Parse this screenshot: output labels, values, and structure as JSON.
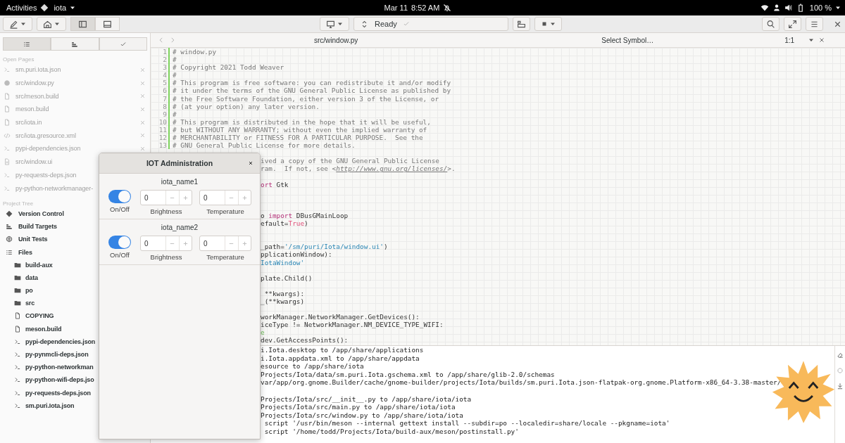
{
  "top_bar": {
    "activities": "Activities",
    "app": "iota",
    "date": "Mar 11",
    "time": "8:52 AM",
    "battery": "100 %"
  },
  "header": {
    "build_status": "Ready",
    "panes": [
      {
        "kind": "sidebar",
        "selected": true
      },
      {
        "kind": "bottom",
        "selected": false
      }
    ]
  },
  "sidebar": {
    "tabs": [
      {
        "kind": "list",
        "selected": true
      },
      {
        "kind": "targets",
        "selected": false
      },
      {
        "kind": "check",
        "selected": false
      }
    ],
    "open_pages_title": "Open Pages",
    "open_pages": [
      {
        "label": "sm.puri.Iota.json",
        "kind": "terminal"
      },
      {
        "label": "src/window.py",
        "kind": "python"
      },
      {
        "label": "src/meson.build",
        "kind": "file"
      },
      {
        "label": "meson.build",
        "kind": "file"
      },
      {
        "label": "src/iota.in",
        "kind": "file"
      },
      {
        "label": "src/iota.gresource.xml",
        "kind": "code"
      },
      {
        "label": "pypi-dependencies.json",
        "kind": "terminal"
      },
      {
        "label": "src/window.ui",
        "kind": "ui"
      },
      {
        "label": "py-requests-deps.json",
        "kind": "terminal"
      },
      {
        "label": "py-python-networkmanager-",
        "kind": "terminal"
      }
    ],
    "project_tree_title": "Project Tree",
    "project_tree": [
      {
        "label": "Version Control",
        "kind": "git"
      },
      {
        "label": "Build Targets",
        "kind": "targets"
      },
      {
        "label": "Unit Tests",
        "kind": "tests"
      },
      {
        "label": "Files",
        "kind": "list",
        "children": [
          {
            "label": "build-aux",
            "kind": "folder"
          },
          {
            "label": "data",
            "kind": "folder"
          },
          {
            "label": "po",
            "kind": "folder"
          },
          {
            "label": "src",
            "kind": "folder"
          },
          {
            "label": "COPYING",
            "kind": "file"
          },
          {
            "label": "meson.build",
            "kind": "file"
          },
          {
            "label": "pypi-dependencies.json",
            "kind": "terminal"
          },
          {
            "label": "py-pynmcli-deps.json",
            "kind": "terminal"
          },
          {
            "label": "py-python-networkman",
            "kind": "terminal"
          },
          {
            "label": "py-python-wifi-deps.jso",
            "kind": "terminal"
          },
          {
            "label": "py-requests-deps.json",
            "kind": "terminal"
          },
          {
            "label": "sm.puri.Iota.json",
            "kind": "terminal"
          }
        ]
      }
    ]
  },
  "editor": {
    "title": "src/window.py",
    "symbol_selector": "Select Symbol…",
    "cursor_position": "1:1",
    "lines": [
      {
        "kind": "numbered",
        "n": "1",
        "text": "# window.py"
      },
      {
        "kind": "numbered",
        "n": "2",
        "text": "#"
      },
      {
        "kind": "numbered",
        "n": "3",
        "text": "# Copyright 2021 Todd Weaver"
      },
      {
        "kind": "numbered",
        "n": "4",
        "text": "#"
      },
      {
        "kind": "numbered",
        "n": "5",
        "text": "# This program is free software: you can redistribute it and/or modify"
      },
      {
        "kind": "numbered",
        "n": "6",
        "text": "# it under the terms of the GNU General Public License as published by"
      },
      {
        "kind": "numbered",
        "n": "7",
        "text": "# the Free Software Foundation, either version 3 of the License, or"
      },
      {
        "kind": "numbered",
        "n": "8",
        "text": "# (at your option) any later version."
      },
      {
        "kind": "numbered",
        "n": "9",
        "text": "#"
      },
      {
        "kind": "numbered",
        "n": "10",
        "text": "# This program is distributed in the hope that it will be useful,"
      },
      {
        "kind": "numbered",
        "n": "11",
        "text": "# but WITHOUT ANY WARRANTY; without even the implied warranty of"
      },
      {
        "kind": "numbered",
        "n": "12",
        "text": "# MERCHANTABILITY or FITNESS FOR A PARTICULAR PURPOSE.  See the"
      },
      {
        "kind": "numbered",
        "n": "13",
        "text": "# GNU General Public License for more details."
      },
      {
        "kind": "covered"
      },
      {
        "kind": "covered",
        "text": "ived a copy of the GNU General Public License"
      },
      {
        "kind": "covered",
        "spans": [
          {
            "text": "ram.  If not, see <",
            "kind": "comment"
          },
          {
            "text": "http://www.gnu.org/licenses/",
            "kind": "link"
          },
          {
            "text": ">.",
            "kind": "comment"
          }
        ]
      },
      {
        "kind": "covered"
      },
      {
        "kind": "covered",
        "spans": [
          {
            "text": "ort",
            "kind": "keyword"
          },
          {
            "text": " Gtk",
            "kind": "plain"
          }
        ]
      },
      {
        "kind": "covered"
      },
      {
        "kind": "covered"
      },
      {
        "kind": "covered"
      },
      {
        "kind": "covered",
        "spans": [
          {
            "text": "o ",
            "kind": "plain"
          },
          {
            "text": "import",
            "kind": "keyword"
          },
          {
            "text": " DBusGMainLoop",
            "kind": "plain"
          }
        ]
      },
      {
        "kind": "covered",
        "spans": [
          {
            "text": "efault=",
            "kind": "plain"
          },
          {
            "text": "True",
            "kind": "constant"
          },
          {
            "text": ")",
            "kind": "plain"
          }
        ]
      },
      {
        "kind": "covered"
      },
      {
        "kind": "covered"
      },
      {
        "kind": "covered",
        "spans": [
          {
            "text": "_path=",
            "kind": "plain"
          },
          {
            "text": "'/sm/puri/Iota/window.ui'",
            "kind": "string"
          },
          {
            "text": ")",
            "kind": "plain"
          }
        ]
      },
      {
        "kind": "covered",
        "spans": [
          {
            "text": "pplicationWindow):",
            "kind": "plain"
          }
        ]
      },
      {
        "kind": "covered",
        "spans": [
          {
            "text": "IotaWindow'",
            "kind": "string"
          }
        ]
      },
      {
        "kind": "covered"
      },
      {
        "kind": "covered",
        "spans": [
          {
            "text": "plate.Child()",
            "kind": "plain"
          }
        ]
      },
      {
        "kind": "covered"
      },
      {
        "kind": "covered",
        "spans": [
          {
            "text": " **kwargs):",
            "kind": "plain"
          }
        ]
      },
      {
        "kind": "covered",
        "spans": [
          {
            "text": "_(**kwargs)",
            "kind": "plain"
          }
        ]
      },
      {
        "kind": "covered"
      },
      {
        "kind": "covered",
        "spans": [
          {
            "text": "workManager.NetworkManager.GetDevices():",
            "kind": "plain"
          }
        ]
      },
      {
        "kind": "covered",
        "spans": [
          {
            "text": "iceType != NetworkManager.NM_DEVICE_TYPE_WIFI:",
            "kind": "plain"
          }
        ]
      },
      {
        "kind": "covered",
        "spans": [
          {
            "text": "e",
            "kind": "builtin"
          }
        ]
      },
      {
        "kind": "covered",
        "spans": [
          {
            "text": "dev.GetAccessPoints():",
            "kind": "plain"
          }
        ]
      }
    ]
  },
  "terminal": {
    "blocks": [
      [
        "i.Iota.desktop to /app/share/applications",
        "i.Iota.appdata.xml to /app/share/appdata",
        "esource to /app/share/iota",
        "Projects/Iota/data/sm.puri.Iota.gschema.xml to /app/share/glib-2.0/schemas",
        "var/app/org.gnome.Builder/cache/gnome-builder/projects/Iota/builds/sm.puri.Iota.json-flatpak-org.gnome.Platform-x86_64-3.38-master/"
      ],
      [
        "Projects/Iota/src/__init__.py to /app/share/iota/iota",
        "Projects/Iota/src/main.py to /app/share/iota/iota",
        "Projects/Iota/src/window.py to /app/share/iota/iota",
        " script '/usr/bin/meson --internal gettext install --subdir=po --localedir=share/locale --pkgname=iota'",
        " script '/home/todd/Projects/Iota/build-aux/meson/postinstall.py'"
      ]
    ]
  },
  "dialog": {
    "title": "IOT Administration",
    "devices": [
      {
        "name": "iota_name1",
        "on": true,
        "switch_label": "On/Off",
        "controls": [
          {
            "value": "0",
            "label": "Brightness"
          },
          {
            "value": "0",
            "label": "Temperature"
          }
        ]
      },
      {
        "name": "iota_name2",
        "on": true,
        "switch_label": "On/Off",
        "controls": [
          {
            "value": "0",
            "label": "Brightness"
          },
          {
            "value": "0",
            "label": "Temperature"
          }
        ]
      }
    ]
  }
}
